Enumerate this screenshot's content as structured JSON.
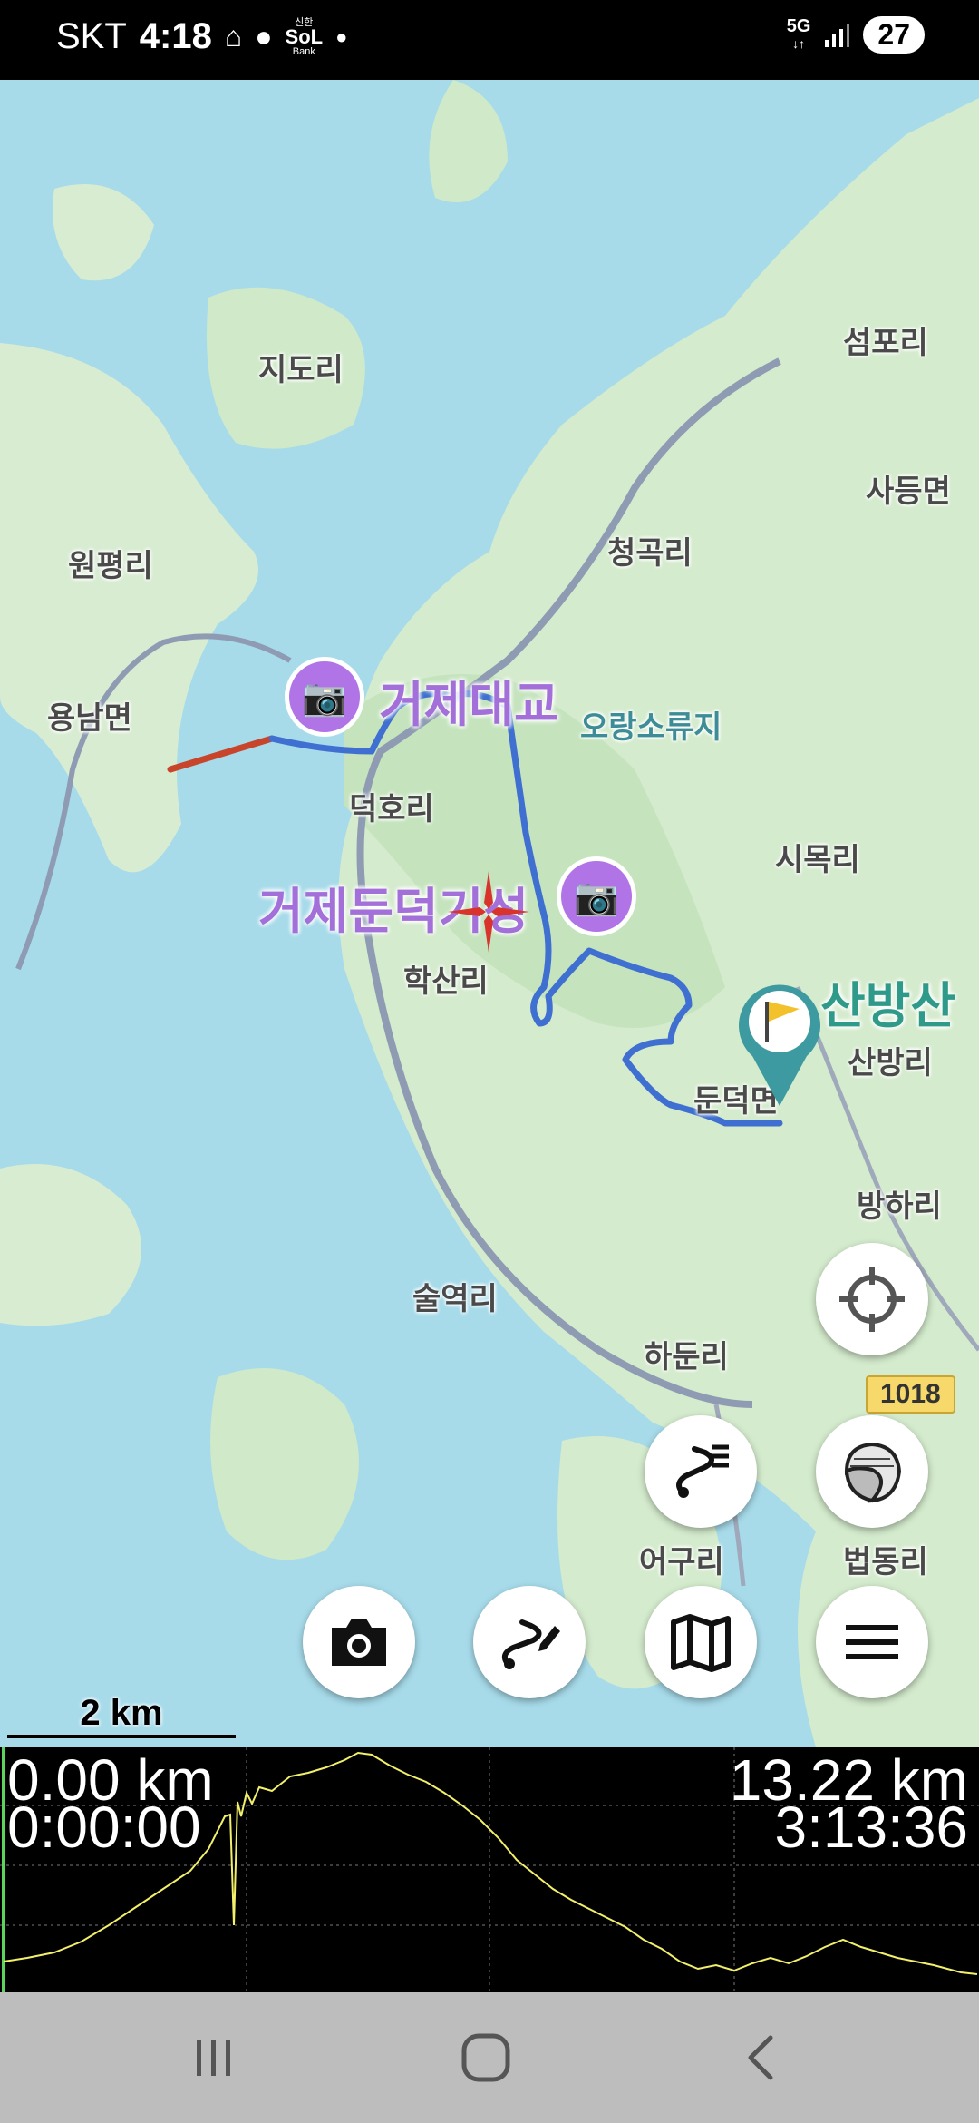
{
  "status_bar": {
    "carrier": "SKT",
    "time": "4:18",
    "bank_label_top": "신한",
    "bank_label_sol": "SoL",
    "bank_label_bottom": "Bank",
    "network": "5G",
    "battery": "27"
  },
  "map": {
    "place_labels": [
      "섬포리",
      "지도리",
      "사등면",
      "원평리",
      "청곡리",
      "용남면",
      "오랑소류지",
      "덕호리",
      "시목리",
      "학산리",
      "산방리",
      "둔덕면",
      "방하리",
      "술역리",
      "하둔리",
      "어구리",
      "법동리"
    ],
    "poi_labels": {
      "bridge": "거제대교",
      "castle": "거제둔덕기성",
      "mountain": "산방산"
    },
    "road_badge": "1018",
    "route_color": "#3f6fd0",
    "start_segment_color": "#c8452c"
  },
  "scale": {
    "label": "2 km"
  },
  "elevation": {
    "start_distance": "0.00 km",
    "start_time": "0:00:00",
    "end_distance": "13.22 km",
    "end_time": "3:13:36",
    "line_color": "#f2ef6a"
  },
  "icons": {
    "locate": "crosshair-icon",
    "track_list": "route-list-icon",
    "layers": "map-layers-icon",
    "camera": "camera-icon",
    "draw_route": "route-edit-icon",
    "map": "map-icon",
    "menu": "hamburger-menu-icon",
    "poi": "camera-plus-icon",
    "flag": "flag-pin-icon",
    "nav_recents": "recents-icon",
    "nav_home": "home-icon",
    "nav_back": "back-icon"
  }
}
